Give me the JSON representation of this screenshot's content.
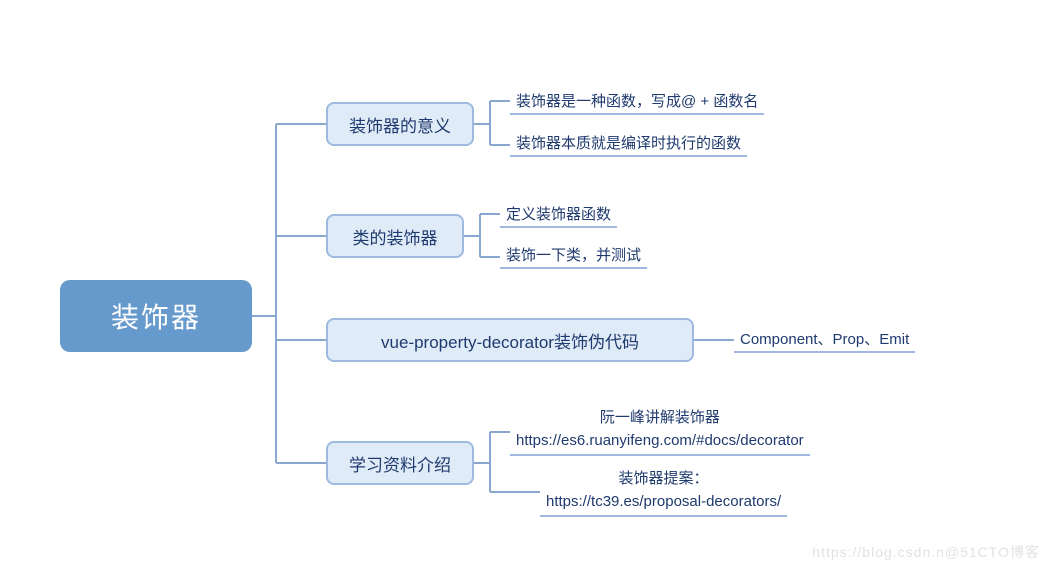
{
  "root": {
    "label": "装饰器"
  },
  "topics": {
    "meaning": {
      "label": "装饰器的意义"
    },
    "classDeco": {
      "label": "类的装饰器"
    },
    "vue": {
      "label": "vue-property-decorator装饰伪代码"
    },
    "materials": {
      "label": "学习资料介绍"
    }
  },
  "leaves": {
    "meaning1": "装饰器是一种函数，写成@ + 函数名",
    "meaning2": "装饰器本质就是编译时执行的函数",
    "classDeco1": "定义装饰器函数",
    "classDeco2": "装饰一下类，并测试",
    "vue1": "Component、Prop、Emit",
    "materials1_line1": "阮一峰讲解装饰器",
    "materials1_line2": "https://es6.ruanyifeng.com/#docs/decorator",
    "materials2_line1": "装饰器提案：",
    "materials2_line2": "https://tc39.es/proposal-decorators/"
  },
  "watermark": "https://blog.csdn.n@51CTO博客"
}
